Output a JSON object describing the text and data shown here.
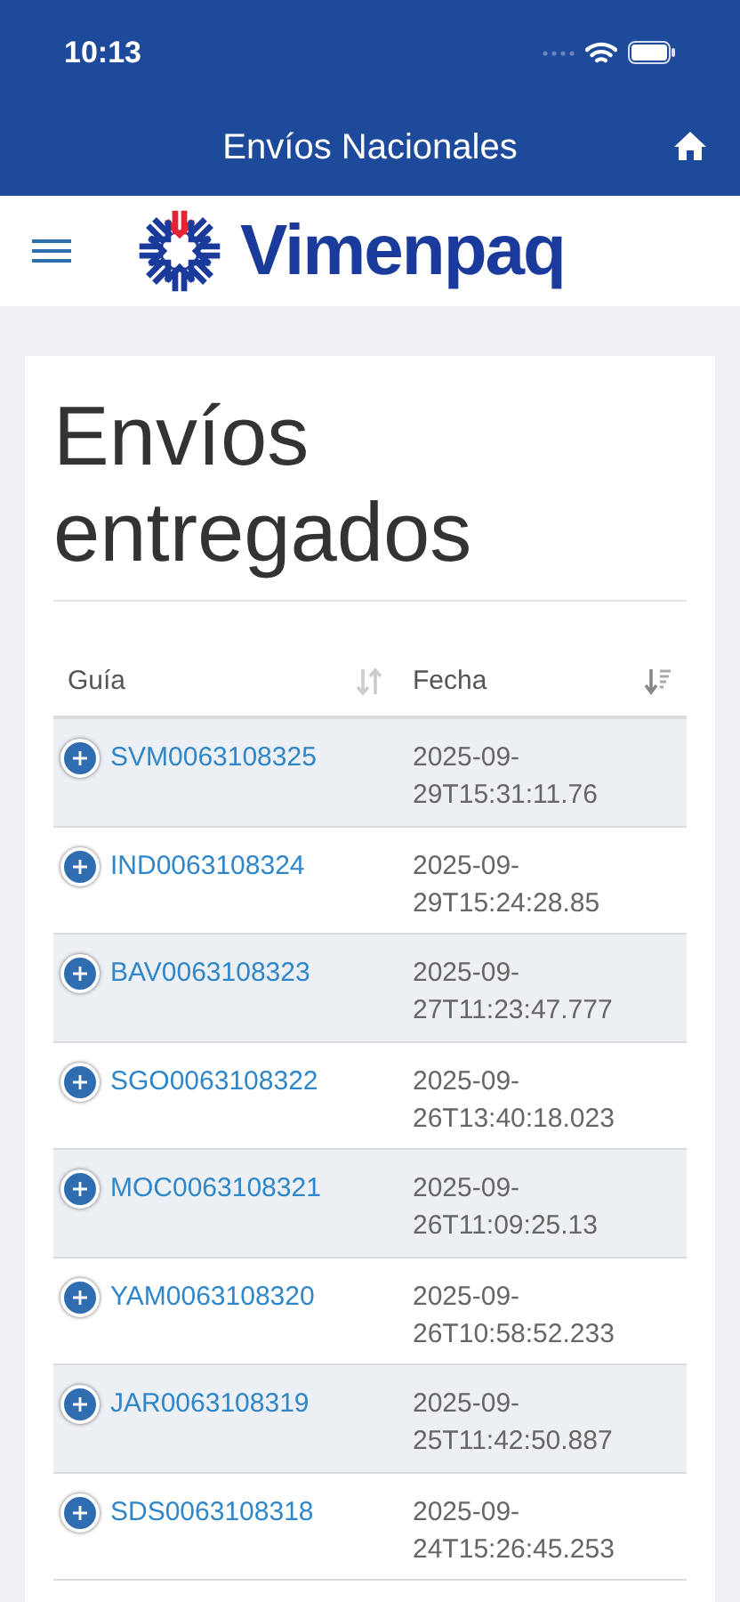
{
  "status_bar": {
    "time": "10:13"
  },
  "nav_bar": {
    "title": "Envíos Nacionales"
  },
  "header": {
    "logo_text": "Vimenpaq"
  },
  "page": {
    "title": "Envíos entregados"
  },
  "table": {
    "columns": [
      {
        "label": "Guía",
        "sorted": false
      },
      {
        "label": "Fecha",
        "sorted": true
      }
    ],
    "rows": [
      {
        "guia": "SVM0063108325",
        "fecha": "2025-09-29T15:31:11.76"
      },
      {
        "guia": "IND0063108324",
        "fecha": "2025-09-29T15:24:28.85"
      },
      {
        "guia": "BAV0063108323",
        "fecha": "2025-09-27T11:23:47.777"
      },
      {
        "guia": "SGO0063108322",
        "fecha": "2025-09-26T13:40:18.023"
      },
      {
        "guia": "MOC0063108321",
        "fecha": "2025-09-26T11:09:25.13"
      },
      {
        "guia": "YAM0063108320",
        "fecha": "2025-09-26T10:58:52.233"
      },
      {
        "guia": "JAR0063108319",
        "fecha": "2025-09-25T11:42:50.887"
      },
      {
        "guia": "SDS0063108318",
        "fecha": "2025-09-24T15:26:45.253"
      }
    ]
  }
}
